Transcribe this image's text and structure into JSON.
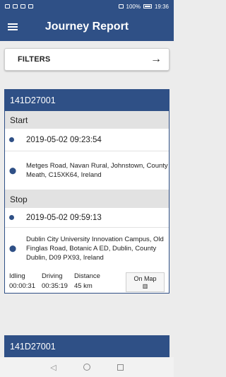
{
  "status": {
    "time": "19:36",
    "battery": "100%"
  },
  "appbar": {
    "title": "Journey Report"
  },
  "filters": {
    "label": "FILTERS"
  },
  "journeys": [
    {
      "vehicle": "141D27001",
      "start_heading": "Start",
      "start_time": "2019-05-02 09:23:54",
      "start_address": "Metges Road, Navan Rural, Johnstown, County Meath, C15XK64, Ireland",
      "stop_heading": "Stop",
      "stop_time": "2019-05-02 09:59:13",
      "stop_address": "Dublin City University Innovation Campus, Old Finglas Road, Botanic A ED, Dublin, County Dublin, D09 PX93, Ireland",
      "idling_label": "Idling",
      "idling": "00:00:31",
      "driving_label": "Driving",
      "driving": "00:35:19",
      "distance_label": "Distance",
      "distance": "45 km",
      "map_label": "On Map"
    },
    {
      "vehicle": "141D27001"
    }
  ]
}
